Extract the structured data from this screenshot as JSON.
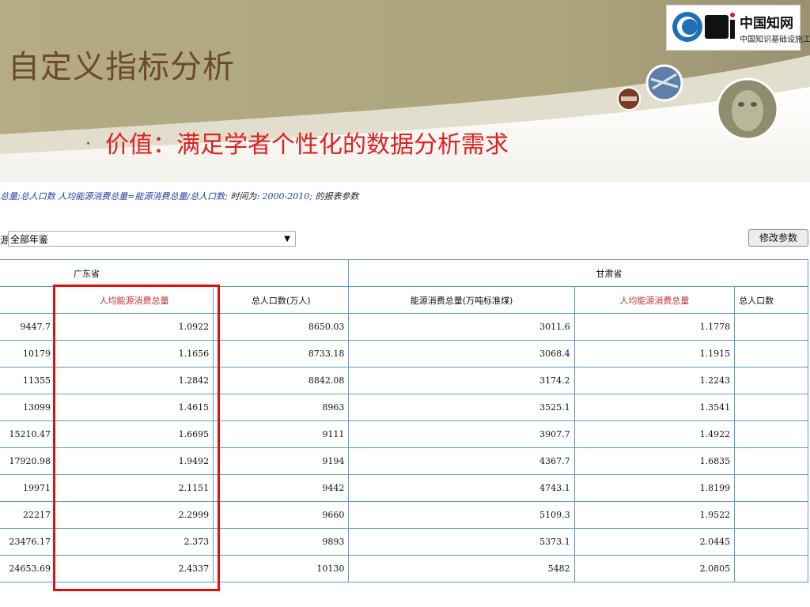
{
  "slide": {
    "title": "自定义指标分析",
    "bullet": "价值：满足学者个性化的数据分析需求",
    "logo": {
      "mark": "CNKi",
      "name": "中国知网",
      "subtitle": "中国知识基础设施工程"
    }
  },
  "formula": {
    "part1": "总量;总人口数 人均能源消费总量=能源消费总量/总人口数;",
    "part2": " 时间为: ",
    "years": "2000-2010;",
    "part3": " 的报表参数"
  },
  "source": {
    "label": "源",
    "value": "全部年鉴"
  },
  "edit_button": "修改参数",
  "table": {
    "groups": [
      "广东省",
      "甘肃省"
    ],
    "columns": [
      "人均能源消费总量",
      "总人口数(万人)",
      "能源消费总量(万吨标准煤)",
      "人均能源消费总量",
      "总人口数"
    ],
    "rows": [
      [
        "9447.7",
        "1.0922",
        "8650.03",
        "3011.6",
        "1.1778"
      ],
      [
        "10179",
        "1.1656",
        "8733.18",
        "3068.4",
        "1.1915"
      ],
      [
        "11355",
        "1.2842",
        "8842.08",
        "3174.2",
        "1.2243"
      ],
      [
        "13099",
        "1.4615",
        "8963",
        "3525.1",
        "1.3541"
      ],
      [
        "15210.47",
        "1.6695",
        "9111",
        "3907.7",
        "1.4922"
      ],
      [
        "17920.98",
        "1.9492",
        "9194",
        "4367.7",
        "1.6835"
      ],
      [
        "19971",
        "2.1151",
        "9442",
        "4743.1",
        "1.8199"
      ],
      [
        "22217",
        "2.2999",
        "9660",
        "5109.3",
        "1.9522"
      ],
      [
        "23476.17",
        "2.373",
        "9893",
        "5373.1",
        "2.0445"
      ],
      [
        "24653.69",
        "2.4337",
        "10130",
        "5482",
        "2.0805"
      ]
    ]
  },
  "colors": {
    "title": "#6b4a2a",
    "bullet": "#e02020",
    "highlight_box": "#e01010",
    "grid": "#5a9ad5"
  }
}
